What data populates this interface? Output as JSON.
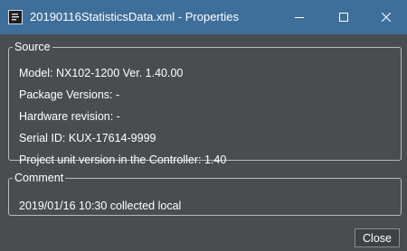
{
  "window": {
    "title": "20190116StatisticsData.xml - Properties",
    "icons": {
      "app": "xml-document-icon",
      "minimize": "minimize-icon",
      "maximize": "maximize-icon",
      "close": "close-icon"
    }
  },
  "source": {
    "legend": "Source",
    "model": "Model: NX102-1200 Ver. 1.40.00",
    "package_versions": "Package Versions: -",
    "hardware_revision": "Hardware revision: -",
    "serial_id": "Serial ID: KUX-17614-9999",
    "project_unit_version": "Project unit version in the Controller: 1.40"
  },
  "comment": {
    "legend": "Comment",
    "text": "2019/01/16 10:30 collected local"
  },
  "footer": {
    "close_label": "Close"
  },
  "colors": {
    "titlebar": "#3e6f9a",
    "background": "#4a4d50",
    "text": "#ffffff",
    "border": "#b8bbbe"
  }
}
